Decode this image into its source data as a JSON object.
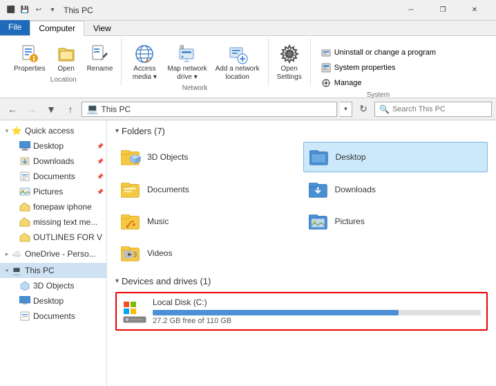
{
  "titleBar": {
    "title": "This PC",
    "icons": [
      "minimize",
      "restore",
      "close"
    ]
  },
  "ribbonTabs": [
    "File",
    "Computer",
    "View"
  ],
  "activeTab": "Computer",
  "ribbonGroups": {
    "location": {
      "label": "Location",
      "buttons": [
        {
          "icon": "📋",
          "label": "Properties"
        },
        {
          "icon": "📂",
          "label": "Open"
        },
        {
          "icon": "✏️",
          "label": "Rename"
        }
      ]
    },
    "network": {
      "label": "Network",
      "buttons": [
        {
          "icon": "🌐",
          "label": "Access media",
          "hasChevron": true
        },
        {
          "icon": "💾",
          "label": "Map network drive",
          "hasChevron": true
        },
        {
          "icon": "📡",
          "label": "Add a network location"
        }
      ]
    },
    "openSettings": {
      "icon": "⚙️",
      "label": "Open Settings"
    },
    "system": {
      "label": "System",
      "items": [
        "Uninstall or change a program",
        "System properties",
        "Manage"
      ]
    }
  },
  "addressBar": {
    "backDisabled": false,
    "forwardDisabled": true,
    "upDisabled": false,
    "path": "This PC",
    "searchPlaceholder": "Search This PC"
  },
  "sidebar": {
    "sections": [
      {
        "type": "header",
        "label": "Quick access",
        "expanded": true,
        "icon": "⭐"
      },
      {
        "label": "Desktop",
        "icon": "desktop",
        "pinned": true,
        "indent": 1
      },
      {
        "label": "Downloads",
        "icon": "downloads",
        "pinned": true,
        "indent": 1
      },
      {
        "label": "Documents",
        "icon": "documents",
        "pinned": true,
        "indent": 1
      },
      {
        "label": "Pictures",
        "icon": "pictures",
        "pinned": true,
        "indent": 1
      },
      {
        "label": "fonepaw iphone",
        "icon": "folder",
        "indent": 1
      },
      {
        "label": "missing text me...",
        "icon": "folder",
        "indent": 1
      },
      {
        "label": "OUTLINES FOR V",
        "icon": "folder-yellow",
        "indent": 1
      },
      {
        "type": "header",
        "label": "OneDrive - Perso...",
        "icon": "cloud",
        "indent": 0
      },
      {
        "type": "header",
        "label": "This PC",
        "icon": "pc",
        "expanded": true,
        "selected": true,
        "indent": 0
      },
      {
        "label": "3D Objects",
        "icon": "3d",
        "indent": 1
      },
      {
        "label": "Desktop",
        "icon": "desktop",
        "indent": 1
      },
      {
        "label": "Documents",
        "icon": "documents",
        "indent": 1
      }
    ]
  },
  "content": {
    "foldersSection": {
      "label": "Folders",
      "count": 7,
      "expanded": true
    },
    "folders": [
      {
        "name": "3D Objects",
        "icon": "3d"
      },
      {
        "name": "Desktop",
        "icon": "desktop",
        "selected": true
      },
      {
        "name": "Documents",
        "icon": "documents"
      },
      {
        "name": "Downloads",
        "icon": "downloads"
      },
      {
        "name": "Music",
        "icon": "music"
      },
      {
        "name": "Pictures",
        "icon": "pictures"
      },
      {
        "name": "Videos",
        "icon": "videos"
      }
    ],
    "devicesSection": {
      "label": "Devices and drives",
      "count": 1,
      "expanded": true
    },
    "devices": [
      {
        "name": "Local Disk (C:)",
        "icon": "disk",
        "freeSpace": "27.2 GB free of 110 GB",
        "usedPercent": 75
      }
    ]
  }
}
